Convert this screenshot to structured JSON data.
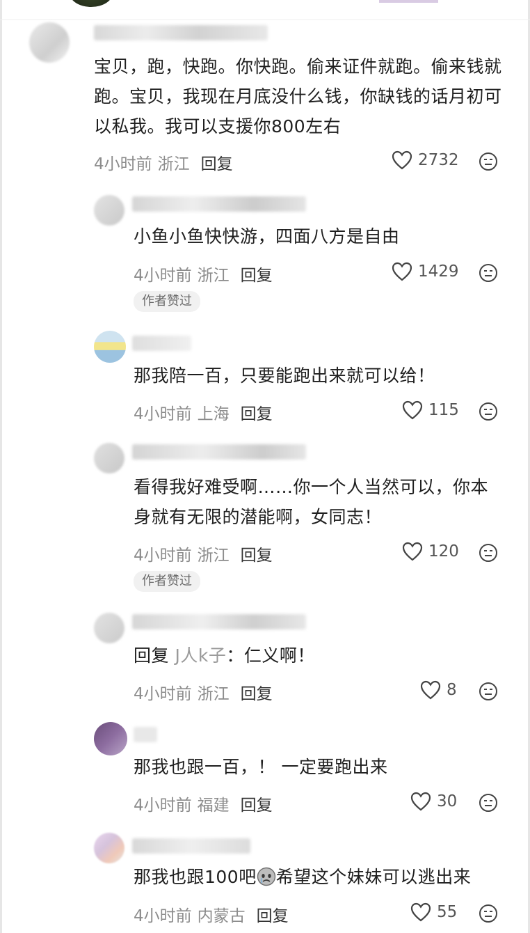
{
  "comments": [
    {
      "text": "宝贝，跑，快跑。你快跑。偷来证件就跑。偷来钱就跑。宝贝，我现在月底没什么钱，你缺钱的话月初可以私我。我可以支援你800左右",
      "time": "4小时前",
      "location": "浙江",
      "reply_label": "回复",
      "likes": "2732"
    },
    {
      "text": "小鱼小鱼快快游，四面八方是自由",
      "time": "4小时前",
      "location": "浙江",
      "reply_label": "回复",
      "likes": "1429",
      "badge": "作者赞过"
    },
    {
      "text": "那我陪一百，只要能跑出来就可以给！",
      "time": "4小时前",
      "location": "上海",
      "reply_label": "回复",
      "likes": "115"
    },
    {
      "text": "看得我好难受啊……你一个人当然可以，你本身就有无限的潜能啊，女同志！",
      "time": "4小时前",
      "location": "浙江",
      "reply_label": "回复",
      "likes": "120",
      "badge": "作者赞过"
    },
    {
      "reply_prefix": "回复",
      "reply_to": "J人k子",
      "text": "：仁义啊！",
      "time": "4小时前",
      "location": "浙江",
      "reply_label": "回复",
      "likes": "8"
    },
    {
      "text": "那我也跟一百，！ 一定要跑出来",
      "time": "4小时前",
      "location": "福建",
      "reply_label": "回复",
      "likes": "30"
    },
    {
      "text_before": "那我也跟100吧",
      "emoji": "crying-face-icon",
      "text_after": "希望这个妹妹可以逃出来",
      "time": "4小时前",
      "location": "内蒙古",
      "reply_label": "回复",
      "likes": "55"
    }
  ]
}
